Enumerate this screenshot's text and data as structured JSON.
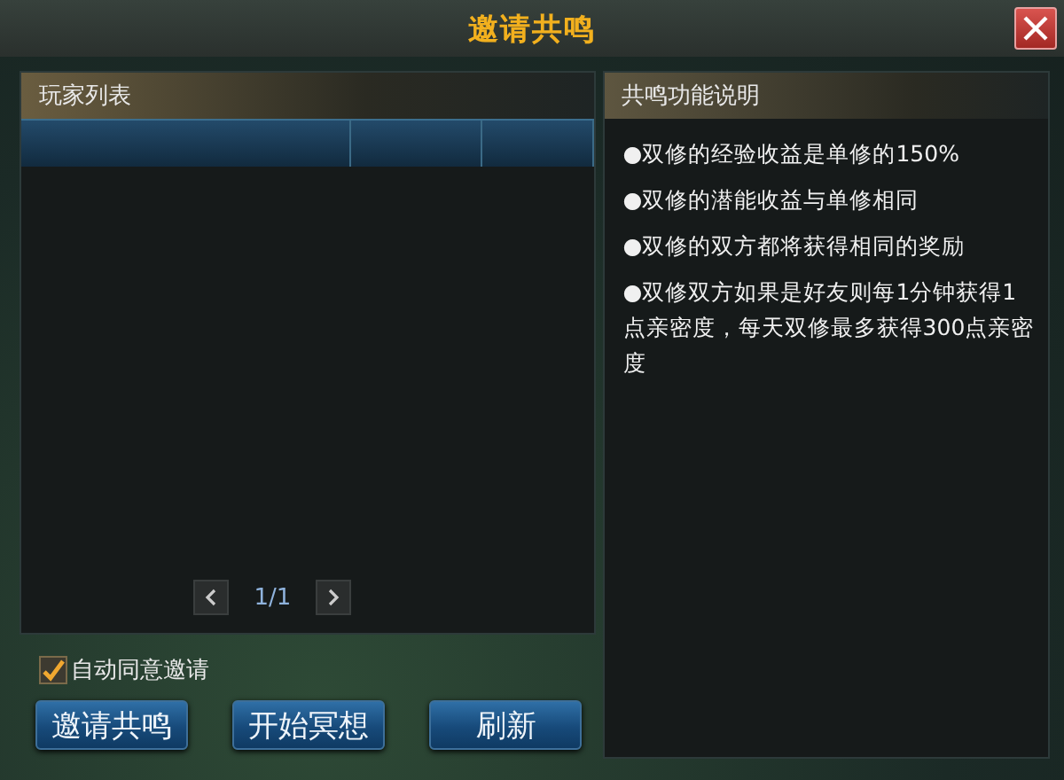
{
  "window": {
    "title": "邀请共鸣"
  },
  "player_list": {
    "title": "玩家列表",
    "page": "1/1"
  },
  "info": {
    "title": "共鸣功能说明",
    "lines": [
      "●双修的经验收益是单修的150%",
      "●双修的潜能收益与单修相同",
      "●双修的双方都将获得相同的奖励",
      "●双修双方如果是好友则每1分钟获得1点亲密度，每天双修最多获得300点亲密度"
    ]
  },
  "auto_accept": {
    "label": "自动同意邀请",
    "checked": true
  },
  "buttons": [
    "邀请共鸣",
    "开始冥想",
    "刷新"
  ]
}
